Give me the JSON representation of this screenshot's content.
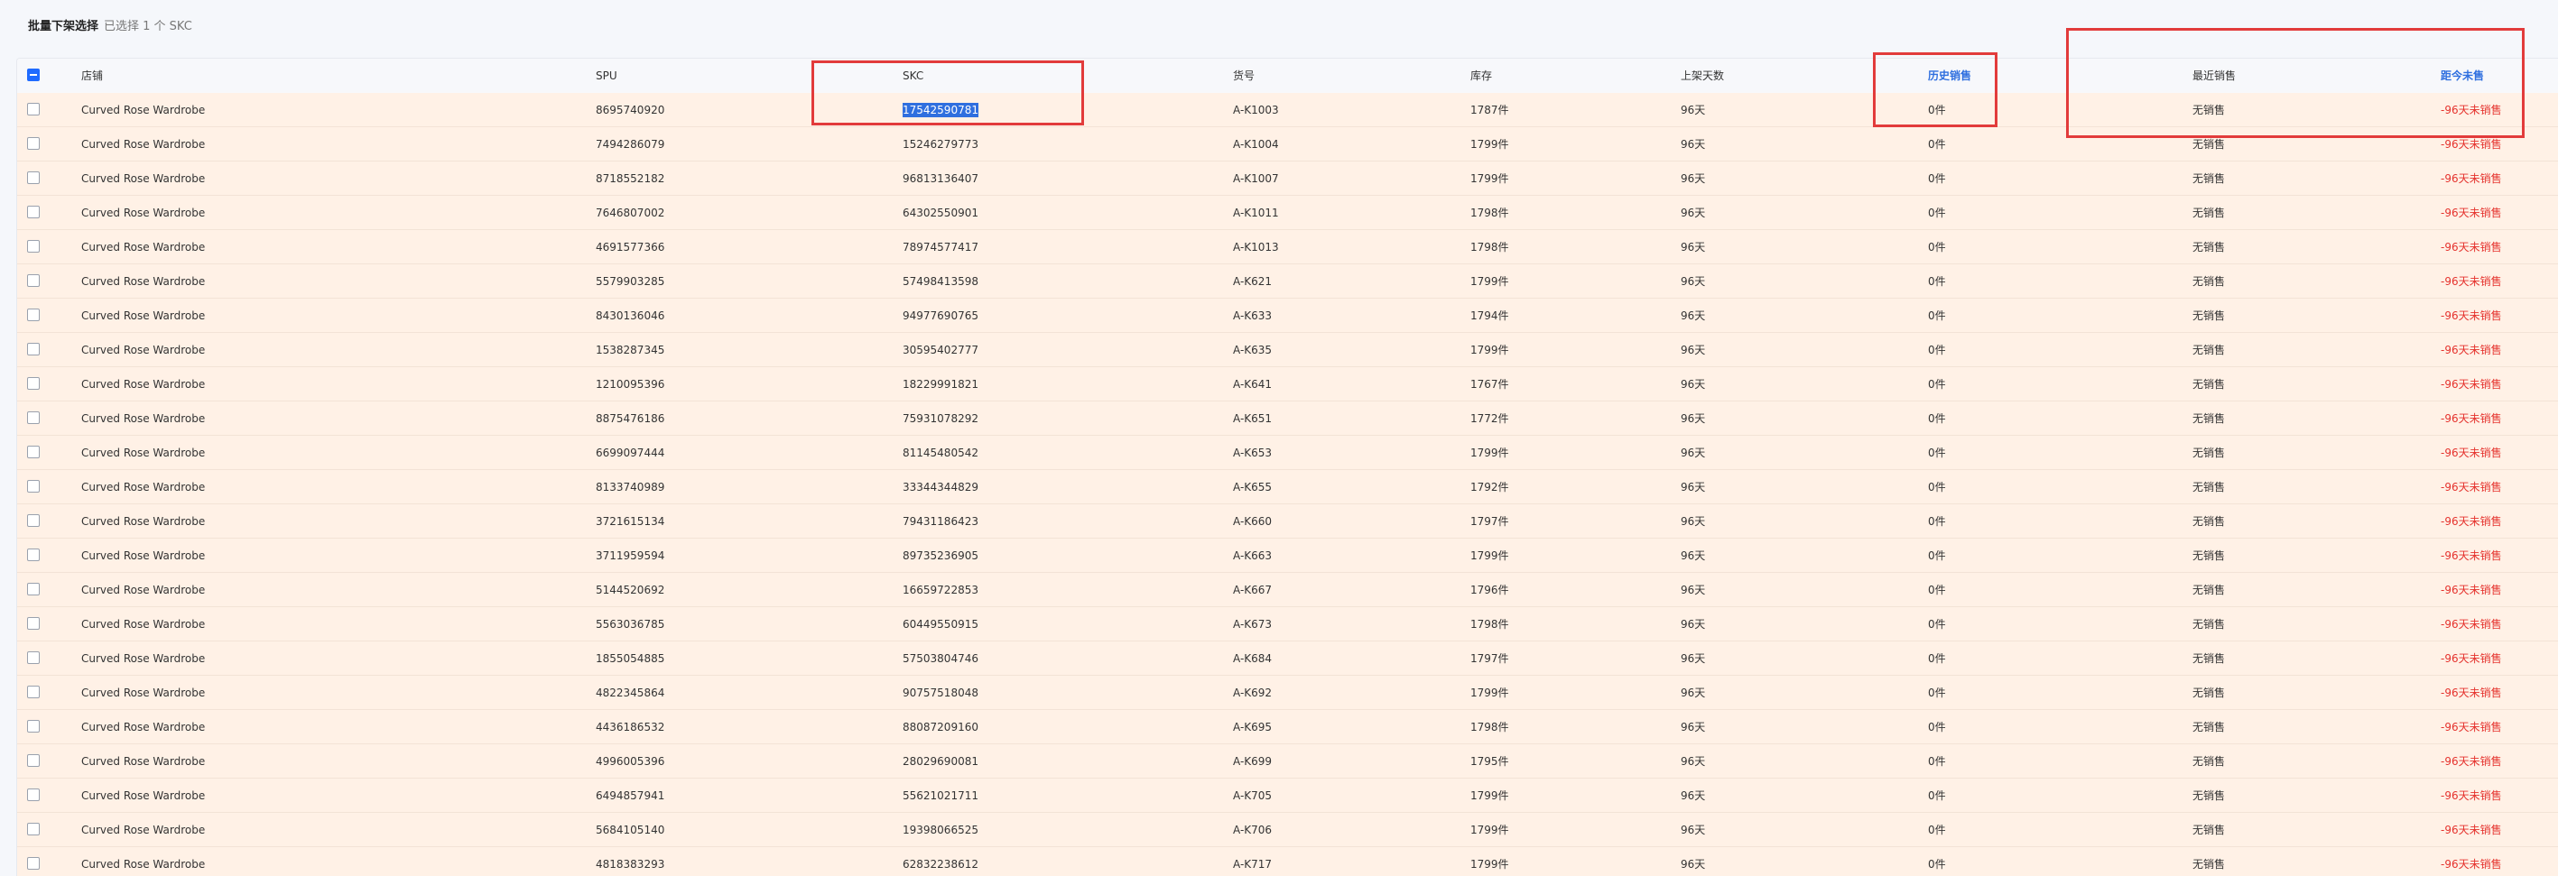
{
  "toolbar": {
    "title": "批量下架选择",
    "selected_text": "已选择 1 个 SKC"
  },
  "table": {
    "columns": {
      "shop": "店铺",
      "spu": "SPU",
      "skc": "SKC",
      "code": "货号",
      "stock": "库存",
      "days": "上架天数",
      "history_sales": "历史销售",
      "last_sale": "最近销售",
      "since_sale": "距今未售"
    },
    "rows": [
      {
        "shop": "Curved Rose Wardrobe",
        "spu": "8695740920",
        "skc": "17542590781",
        "code": "A-K1003",
        "stock": "1787件",
        "days": "96天",
        "history": "0件",
        "last": "无销售",
        "since": "-96天未销售"
      },
      {
        "shop": "Curved Rose Wardrobe",
        "spu": "7494286079",
        "skc": "15246279773",
        "code": "A-K1004",
        "stock": "1799件",
        "days": "96天",
        "history": "0件",
        "last": "无销售",
        "since": "-96天未销售"
      },
      {
        "shop": "Curved Rose Wardrobe",
        "spu": "8718552182",
        "skc": "96813136407",
        "code": "A-K1007",
        "stock": "1799件",
        "days": "96天",
        "history": "0件",
        "last": "无销售",
        "since": "-96天未销售"
      },
      {
        "shop": "Curved Rose Wardrobe",
        "spu": "7646807002",
        "skc": "64302550901",
        "code": "A-K1011",
        "stock": "1798件",
        "days": "96天",
        "history": "0件",
        "last": "无销售",
        "since": "-96天未销售"
      },
      {
        "shop": "Curved Rose Wardrobe",
        "spu": "4691577366",
        "skc": "78974577417",
        "code": "A-K1013",
        "stock": "1798件",
        "days": "96天",
        "history": "0件",
        "last": "无销售",
        "since": "-96天未销售"
      },
      {
        "shop": "Curved Rose Wardrobe",
        "spu": "5579903285",
        "skc": "57498413598",
        "code": "A-K621",
        "stock": "1799件",
        "days": "96天",
        "history": "0件",
        "last": "无销售",
        "since": "-96天未销售"
      },
      {
        "shop": "Curved Rose Wardrobe",
        "spu": "8430136046",
        "skc": "94977690765",
        "code": "A-K633",
        "stock": "1794件",
        "days": "96天",
        "history": "0件",
        "last": "无销售",
        "since": "-96天未销售"
      },
      {
        "shop": "Curved Rose Wardrobe",
        "spu": "1538287345",
        "skc": "30595402777",
        "code": "A-K635",
        "stock": "1799件",
        "days": "96天",
        "history": "0件",
        "last": "无销售",
        "since": "-96天未销售"
      },
      {
        "shop": "Curved Rose Wardrobe",
        "spu": "1210095396",
        "skc": "18229991821",
        "code": "A-K641",
        "stock": "1767件",
        "days": "96天",
        "history": "0件",
        "last": "无销售",
        "since": "-96天未销售"
      },
      {
        "shop": "Curved Rose Wardrobe",
        "spu": "8875476186",
        "skc": "75931078292",
        "code": "A-K651",
        "stock": "1772件",
        "days": "96天",
        "history": "0件",
        "last": "无销售",
        "since": "-96天未销售"
      },
      {
        "shop": "Curved Rose Wardrobe",
        "spu": "6699097444",
        "skc": "81145480542",
        "code": "A-K653",
        "stock": "1799件",
        "days": "96天",
        "history": "0件",
        "last": "无销售",
        "since": "-96天未销售"
      },
      {
        "shop": "Curved Rose Wardrobe",
        "spu": "8133740989",
        "skc": "33344344829",
        "code": "A-K655",
        "stock": "1792件",
        "days": "96天",
        "history": "0件",
        "last": "无销售",
        "since": "-96天未销售"
      },
      {
        "shop": "Curved Rose Wardrobe",
        "spu": "3721615134",
        "skc": "79431186423",
        "code": "A-K660",
        "stock": "1797件",
        "days": "96天",
        "history": "0件",
        "last": "无销售",
        "since": "-96天未销售"
      },
      {
        "shop": "Curved Rose Wardrobe",
        "spu": "3711959594",
        "skc": "89735236905",
        "code": "A-K663",
        "stock": "1799件",
        "days": "96天",
        "history": "0件",
        "last": "无销售",
        "since": "-96天未销售"
      },
      {
        "shop": "Curved Rose Wardrobe",
        "spu": "5144520692",
        "skc": "16659722853",
        "code": "A-K667",
        "stock": "1796件",
        "days": "96天",
        "history": "0件",
        "last": "无销售",
        "since": "-96天未销售"
      },
      {
        "shop": "Curved Rose Wardrobe",
        "spu": "5563036785",
        "skc": "60449550915",
        "code": "A-K673",
        "stock": "1798件",
        "days": "96天",
        "history": "0件",
        "last": "无销售",
        "since": "-96天未销售"
      },
      {
        "shop": "Curved Rose Wardrobe",
        "spu": "1855054885",
        "skc": "57503804746",
        "code": "A-K684",
        "stock": "1797件",
        "days": "96天",
        "history": "0件",
        "last": "无销售",
        "since": "-96天未销售"
      },
      {
        "shop": "Curved Rose Wardrobe",
        "spu": "4822345864",
        "skc": "90757518048",
        "code": "A-K692",
        "stock": "1799件",
        "days": "96天",
        "history": "0件",
        "last": "无销售",
        "since": "-96天未销售"
      },
      {
        "shop": "Curved Rose Wardrobe",
        "spu": "4436186532",
        "skc": "88087209160",
        "code": "A-K695",
        "stock": "1798件",
        "days": "96天",
        "history": "0件",
        "last": "无销售",
        "since": "-96天未销售"
      },
      {
        "shop": "Curved Rose Wardrobe",
        "spu": "4996005396",
        "skc": "28029690081",
        "code": "A-K699",
        "stock": "1795件",
        "days": "96天",
        "history": "0件",
        "last": "无销售",
        "since": "-96天未销售"
      },
      {
        "shop": "Curved Rose Wardrobe",
        "spu": "6494857941",
        "skc": "55621021711",
        "code": "A-K705",
        "stock": "1799件",
        "days": "96天",
        "history": "0件",
        "last": "无销售",
        "since": "-96天未销售"
      },
      {
        "shop": "Curved Rose Wardrobe",
        "spu": "5684105140",
        "skc": "19398066525",
        "code": "A-K706",
        "stock": "1799件",
        "days": "96天",
        "history": "0件",
        "last": "无销售",
        "since": "-96天未销售"
      },
      {
        "shop": "Curved Rose Wardrobe",
        "spu": "4818383293",
        "skc": "62832238612",
        "code": "A-K717",
        "stock": "1799件",
        "days": "96天",
        "history": "0件",
        "last": "无销售",
        "since": "-96天未销售"
      }
    ]
  },
  "colors": {
    "row_bg": "#fff1e6",
    "header_accent": "#2f6fdf",
    "danger": "#e5322d",
    "annotation": "#e23b3b"
  }
}
